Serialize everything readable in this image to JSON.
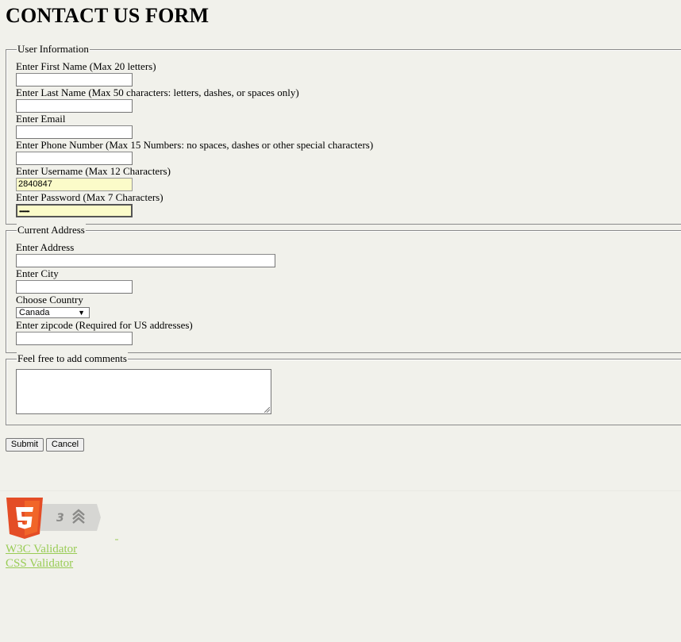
{
  "page": {
    "title": "CONTACT US FORM"
  },
  "user_info": {
    "legend": "User Information",
    "first_name_label": "Enter First Name (Max 20 letters)",
    "first_name_value": "",
    "last_name_label": "Enter Last Name (Max 50 characters: letters, dashes, or spaces only)",
    "last_name_value": "",
    "email_label": "Enter Email",
    "email_value": "",
    "phone_label": "Enter Phone Number (Max 15 Numbers: no spaces, dashes or other special characters)",
    "phone_value": "",
    "username_label": "Enter Username (Max 12 Characters)",
    "username_value": "2840847",
    "password_label": "Enter Password (Max 7 Characters)",
    "password_value": "•••••••"
  },
  "address": {
    "legend": "Current Address",
    "address_label": "Enter Address",
    "address_value": "",
    "city_label": "Enter City",
    "city_value": "",
    "country_label": "Choose Country",
    "country_selected": "Canada",
    "zip_label": "Enter zipcode (Required for US addresses)",
    "zip_value": ""
  },
  "comments": {
    "legend": "Feel free to add comments",
    "value": ""
  },
  "buttons": {
    "submit": "Submit",
    "cancel": "Cancel"
  },
  "footer": {
    "badge_icons": [
      "html5-logo-icon",
      "css3-icon",
      "semantics-icon"
    ],
    "w3c_link": "W3C Validator",
    "css_link": "CSS Validator",
    "link_color": "#99cc55"
  },
  "colors": {
    "background": "#f1f1eb",
    "autofill": "#fbfbc9",
    "html5_orange": "#e44d26"
  }
}
